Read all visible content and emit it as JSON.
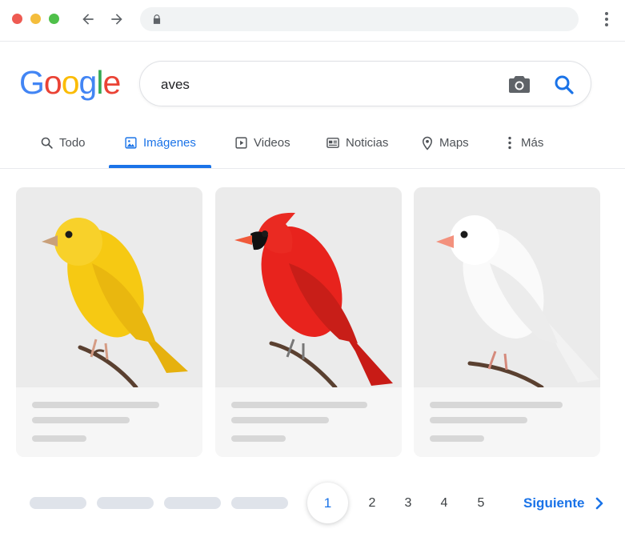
{
  "browser": {
    "buttons": {
      "back_icon": "arrow-left",
      "forward_icon": "arrow-right",
      "menu_icon": "more-vert"
    }
  },
  "logo": {
    "letters": [
      "G",
      "o",
      "o",
      "g",
      "l",
      "e"
    ],
    "colors": [
      "#4285f4",
      "#ea4335",
      "#fbbc05",
      "#4285f4",
      "#34a853",
      "#ea4335"
    ]
  },
  "search": {
    "query": "aves",
    "camera_icon": "camera-icon",
    "search_icon": "search-icon"
  },
  "tabs": [
    {
      "label": "Todo",
      "icon": "search-icon",
      "active": false
    },
    {
      "label": "Imágenes",
      "icon": "image-icon",
      "active": true
    },
    {
      "label": "Videos",
      "icon": "play-icon",
      "active": false
    },
    {
      "label": "Noticias",
      "icon": "news-icon",
      "active": false
    },
    {
      "label": "Maps",
      "icon": "pin-icon",
      "active": false
    },
    {
      "label": "Más",
      "icon": "more-vert-icon",
      "active": false
    }
  ],
  "results": [
    {
      "subject": "yellow-canary",
      "color": "#f6c913"
    },
    {
      "subject": "red-cardinal",
      "color": "#e8231d"
    },
    {
      "subject": "white-finch",
      "color": "#f7f7f7"
    }
  ],
  "pagination": {
    "current": "1",
    "pages": [
      "2",
      "3",
      "4",
      "5"
    ],
    "next_label": "Siguiente"
  },
  "colors": {
    "accent": "#1a73e8",
    "text": "#202124",
    "muted": "#4d5156"
  }
}
